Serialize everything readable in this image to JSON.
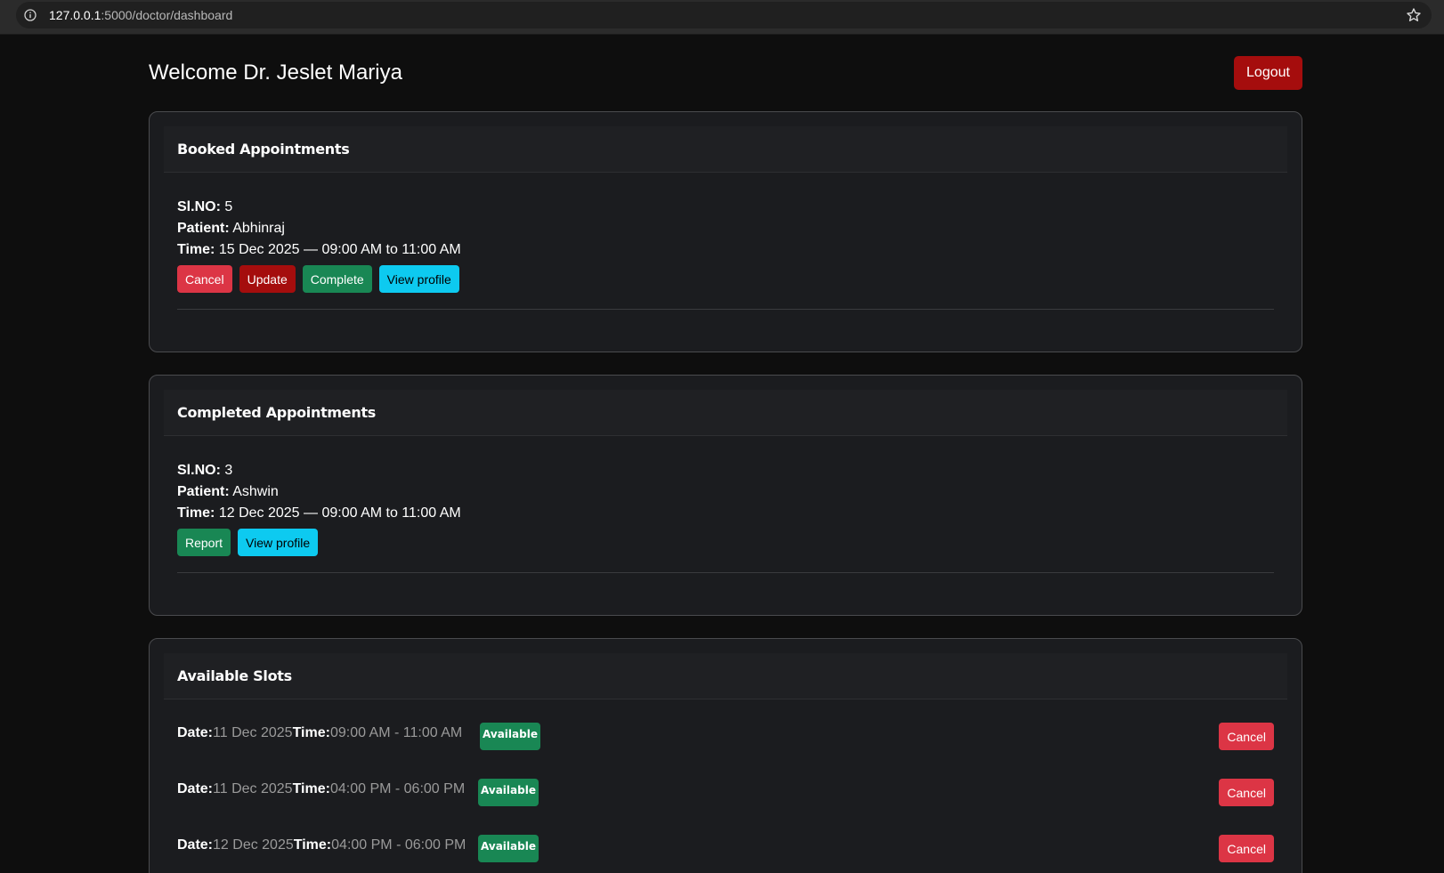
{
  "browser": {
    "url_host": "127.0.0.1",
    "url_path": ":5000/doctor/dashboard"
  },
  "header": {
    "title": "Welcome Dr. Jeslet Mariya",
    "logout_label": "Logout"
  },
  "booked": {
    "title": "Booked Appointments",
    "sl_label": "Sl.NO:",
    "sl_value": "5",
    "patient_label": "Patient:",
    "patient_value": "Abhinraj",
    "time_label": "Time:",
    "time_value": "15 Dec 2025 — 09:00 AM to 11:00 AM",
    "buttons": {
      "cancel": "Cancel",
      "update": "Update",
      "complete": "Complete",
      "view_profile": "View profile"
    }
  },
  "completed": {
    "title": "Completed Appointments",
    "sl_label": "Sl.NO:",
    "sl_value": "3",
    "patient_label": "Patient:",
    "patient_value": "Ashwin",
    "time_label": "Time:",
    "time_value": "12 Dec 2025 — 09:00 AM to 11:00 AM",
    "buttons": {
      "report": "Report",
      "view_profile": "View profile"
    }
  },
  "slots": {
    "title": "Available Slots",
    "date_label": "Date:",
    "time_label": "Time:",
    "items": [
      {
        "date": "11 Dec 2025",
        "time": "09:00 AM - 11:00 AM",
        "status": "Available",
        "cancel": "Cancel"
      },
      {
        "date": "11 Dec 2025",
        "time": "04:00 PM - 06:00 PM",
        "status": "Available",
        "cancel": "Cancel"
      },
      {
        "date": "12 Dec 2025",
        "time": "04:00 PM - 06:00 PM",
        "status": "Available",
        "cancel": "Cancel"
      }
    ]
  },
  "colors": {
    "background": "#0e0e0e",
    "card": "#1b1c1f",
    "danger": "#dc3545",
    "dark_red": "#a50d0d",
    "success": "#198754",
    "info": "#0dcaf0"
  },
  "icons": {
    "site_info": "info-icon",
    "bookmark": "star-icon"
  }
}
